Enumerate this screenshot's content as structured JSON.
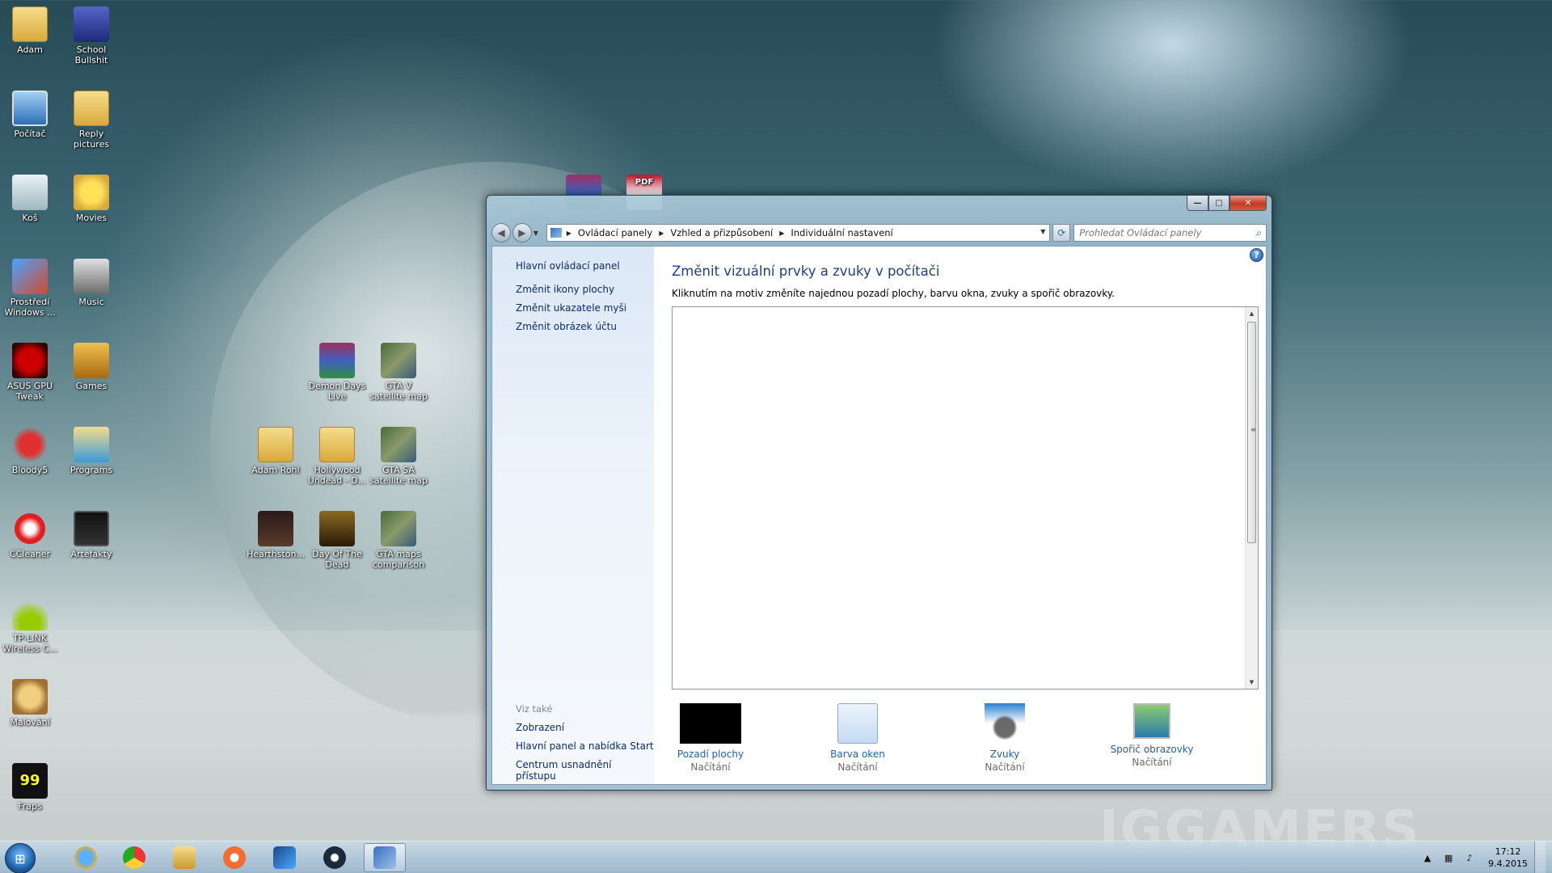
{
  "desktop": {
    "icons": [
      {
        "label": "Adam",
        "icon": "user-folder-icon"
      },
      {
        "label": "School Bullshit",
        "icon": "book-icon"
      },
      {
        "label": "Počítač",
        "icon": "computer-icon"
      },
      {
        "label": "Reply pictures",
        "icon": "folder-icon"
      },
      {
        "label": "Koš",
        "icon": "recycle-bin-icon"
      },
      {
        "label": "Movies",
        "icon": "star-folder-icon"
      },
      {
        "label": "Prostředí Windows ...",
        "icon": "windows-app-icon"
      },
      {
        "label": "Music",
        "icon": "music-icon"
      },
      {
        "label": "ASUS GPU Tweak",
        "icon": "gpu-tweak-icon"
      },
      {
        "label": "Games",
        "icon": "games-icon"
      },
      {
        "label": "Bloody5",
        "icon": "bloody-icon"
      },
      {
        "label": "Programs",
        "icon": "programs-folder-icon"
      },
      {
        "label": "CCleaner",
        "icon": "ccleaner-icon"
      },
      {
        "label": "Artefakty",
        "icon": "monitor-icon"
      },
      {
        "label": "TP-LINK Wireless C...",
        "icon": "wireless-icon"
      },
      {
        "label": "Malování",
        "icon": "paint-icon"
      },
      {
        "label": "Fraps",
        "icon": "fraps-icon",
        "glyph": "99"
      },
      {
        "label": "Demon Days Live",
        "icon": "winrar-icon"
      },
      {
        "label": "GTA V satellite map",
        "icon": "map-icon"
      },
      {
        "label": "Adam Rohl",
        "icon": "folder-icon"
      },
      {
        "label": "Hollywood Undead - D...",
        "icon": "folder-icon"
      },
      {
        "label": "GTA SA satellite map",
        "icon": "map-icon"
      },
      {
        "label": "Hearthston...",
        "icon": "game-icon"
      },
      {
        "label": "Day Of The Dead",
        "icon": "folder-icon"
      },
      {
        "label": "GTA maps comparison",
        "icon": "map-icon"
      }
    ],
    "floating_pdf_label": "PDF",
    "watermark": "IGGAMERS"
  },
  "window": {
    "controls": {
      "minimize": "—",
      "maximize": "▢",
      "close": "✕"
    },
    "nav": {
      "back": "◀",
      "forward": "▶"
    },
    "breadcrumb": [
      "Ovládací panely",
      "Vzhled a přizpůsobení",
      "Individuální nastavení"
    ],
    "search_placeholder": "Prohledat Ovládací panely",
    "sidebar": {
      "home": "Hlavní ovládací panel",
      "links": [
        "Změnit ikony plochy",
        "Změnit ukazatele myši",
        "Změnit obrázek účtu"
      ],
      "see_also_label": "Viz také",
      "see_also": [
        "Zobrazení",
        "Hlavní panel a nabídka Start",
        "Centrum usnadnění přístupu"
      ]
    },
    "main": {
      "title": "Změnit vizuální prvky a zvuky v počítači",
      "description": "Kliknutím na motiv změníte najednou pozadí plochy, barvu okna, zvuky a spořič obrazovky.",
      "help": "?",
      "options": [
        {
          "label": "Pozadí plochy",
          "status": "Načítání",
          "icon": "desktop-background-icon"
        },
        {
          "label": "Barva oken",
          "status": "Načítání",
          "icon": "window-color-icon"
        },
        {
          "label": "Zvuky",
          "status": "Načítání",
          "icon": "sounds-icon"
        },
        {
          "label": "Spořič obrazovky",
          "status": "Načítání",
          "icon": "screensaver-icon"
        }
      ]
    }
  },
  "taskbar": {
    "apps": [
      {
        "name": "internet-explorer",
        "icon": "ie-icon"
      },
      {
        "name": "chrome",
        "icon": "chrome-icon"
      },
      {
        "name": "file-explorer",
        "icon": "explorer-icon"
      },
      {
        "name": "origin",
        "icon": "origin-icon"
      },
      {
        "name": "battle-net",
        "icon": "battlenet-icon"
      },
      {
        "name": "steam",
        "icon": "steam-icon"
      },
      {
        "name": "control-panel",
        "icon": "control-panel-icon",
        "active": true
      }
    ],
    "tray": {
      "time": "17:12",
      "date": "9.4.2015"
    }
  }
}
